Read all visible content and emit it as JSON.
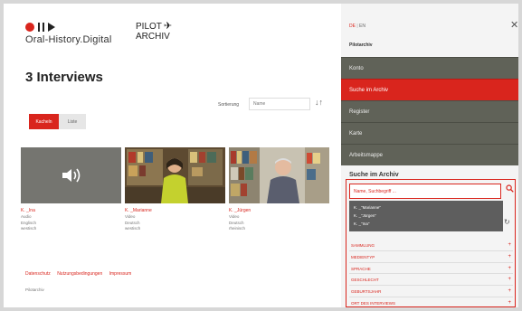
{
  "header": {
    "logo_text": "Oral-History.Digital",
    "pilot_line1": "PILOT",
    "pilot_line2": "ARCHIV"
  },
  "main": {
    "title": "3 Interviews",
    "sort_label": "Sortierung",
    "sort_value": "Name",
    "sort_arrows": "↓↑",
    "view_tiles_label": "Kacheln",
    "view_list_label": "Liste",
    "cards": [
      {
        "name": "K. _Ina",
        "meta": [
          "Audio",
          "Englisch",
          "westisch"
        ]
      },
      {
        "name": "K. _Marianne",
        "meta": [
          "Video",
          "Deutsch",
          "westisch"
        ]
      },
      {
        "name": "K. _Jürgen",
        "meta": [
          "Video",
          "Deutsch",
          "rheinisch"
        ]
      }
    ]
  },
  "footer": {
    "links": [
      "Datenschutz",
      "Nutzungsbedingungen",
      "Impressum"
    ],
    "sub": "Pilotarchiv"
  },
  "sidebar": {
    "lang_de": "DE",
    "lang_sep": "|",
    "lang_en": "EN",
    "close": "✕",
    "subtitle": "Pilotarchiv",
    "menu": [
      "Konto",
      "Suche im Archiv",
      "Register",
      "Karte",
      "Arbeitsmappe"
    ],
    "active_menu": "Suche im Archiv",
    "search_title": "Suche im Archiv",
    "search_placeholder": "Name, Suchbegriff ...",
    "suggestions": [
      "K. _\"Marianne\"",
      "K. _\"Jürgen\"",
      "K. _\"Ina\""
    ],
    "facets": [
      "SAMMLUNG",
      "MEDIENTYP",
      "SPRACHE",
      "GESCHLECHT",
      "GEBURTSJAHR",
      "ORT DES INTERVIEWS"
    ]
  },
  "colors": {
    "accent": "#d9251d",
    "menu_bg": "#606258"
  }
}
